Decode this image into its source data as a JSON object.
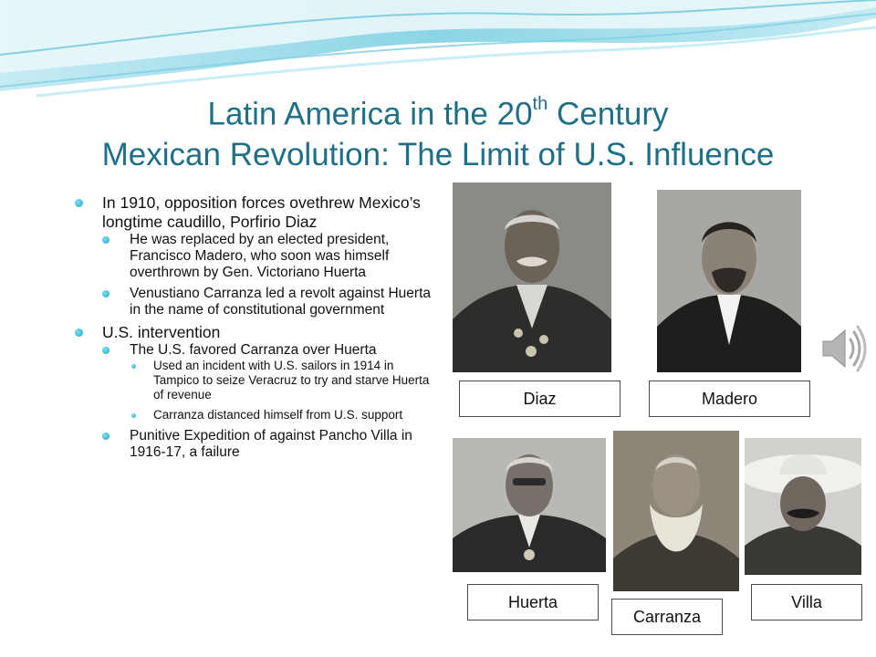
{
  "slide": {
    "title_line1_main": "Latin America in the 20",
    "title_line1_sup": "th",
    "title_line1_tail": " Century",
    "title_line2": "Mexican Revolution: The Limit of U.S. Influence"
  },
  "bullets": {
    "b1": "In 1910, opposition forces ovethrew Mexico’s longtime caudillo, Porfirio Diaz",
    "b1_1": "He was replaced by an elected president, Francisco Madero, who soon was himself overthrown by Gen. Victoriano Huerta",
    "b1_2": "Venustiano Carranza led a revolt against Huerta in the name of constitutional government",
    "b2": "U.S. intervention",
    "b2_1": "The U.S. favored Carranza over Huerta",
    "b2_1_1": "Used an incident with U.S. sailors in 1914 in Tampico to seize Veracruz to try and starve Huerta of revenue",
    "b2_1_2": "Carranza distanced himself from U.S. support",
    "b2_2": "Punitive Expedition of against Pancho Villa in 1916-17, a failure"
  },
  "portraits": {
    "diaz": "Diaz",
    "madero": "Madero",
    "huerta": "Huerta",
    "carranza": "Carranza",
    "villa": "Villa"
  },
  "icons": {
    "audio": "speaker-icon"
  },
  "colors": {
    "title": "#1f6f86",
    "bullet": "#1ba8c4",
    "wave": "#9fdbe8"
  }
}
